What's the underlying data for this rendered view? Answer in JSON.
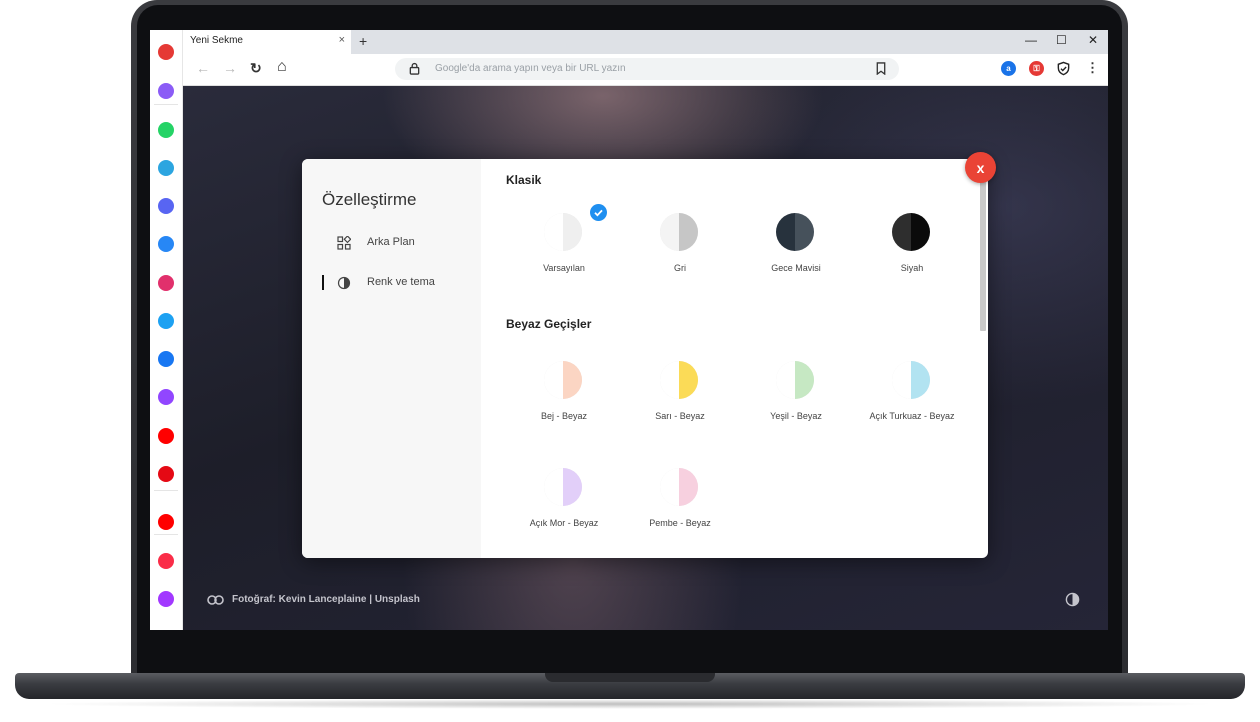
{
  "browser": {
    "tab_title": "Yeni Sekme",
    "tab_close": "×",
    "new_tab": "+",
    "window_controls": {
      "minimize": "—",
      "maximize": "☐",
      "close": "✕"
    },
    "nav": {
      "back": "←",
      "forward": "→",
      "reload": "↻",
      "home": "⌂"
    },
    "omnibox_placeholder": "Google'da arama yapın veya bir URL yazın",
    "menu": "⋮"
  },
  "sidebar_icons": [
    {
      "name": "app-logo-icon",
      "color": "#e53935"
    },
    {
      "name": "messenger-icon",
      "color": "#8b5cf6"
    },
    {
      "name": "whatsapp-icon",
      "color": "#25d366"
    },
    {
      "name": "telegram-icon",
      "color": "#2ca5e0"
    },
    {
      "name": "discord-icon",
      "color": "#5865f2"
    },
    {
      "name": "vk-icon",
      "color": "#2787f5"
    },
    {
      "name": "instagram-icon",
      "color": "#e1306c"
    },
    {
      "name": "twitter-icon",
      "color": "#1da1f2"
    },
    {
      "name": "facebook-icon",
      "color": "#1877f2"
    },
    {
      "name": "twitch-icon",
      "color": "#9146ff"
    },
    {
      "name": "youtube-icon",
      "color": "#ff0000"
    },
    {
      "name": "netflix-icon",
      "color": "#e50914"
    },
    {
      "name": "youtube-music-icon",
      "color": "#ff0000"
    },
    {
      "name": "apple-music-icon",
      "color": "#fa2d48"
    },
    {
      "name": "deezer-icon",
      "color": "#a238ff"
    }
  ],
  "customize": {
    "title": "Özelleştirme",
    "menu": [
      {
        "label": "Arka Plan",
        "icon": "grid-icon",
        "active": false
      },
      {
        "label": "Renk ve tema",
        "icon": "contrast-icon",
        "active": true
      }
    ],
    "sections": [
      {
        "title": "Klasik",
        "items": [
          {
            "label": "Varsayılan",
            "left": "#ffffff",
            "right": "#efefef",
            "selected": true
          },
          {
            "label": "Gri",
            "left": "#f4f4f4",
            "right": "#c6c6c6",
            "selected": false
          },
          {
            "label": "Gece Mavisi",
            "left": "#27323d",
            "right": "#46515b",
            "selected": false
          },
          {
            "label": "Siyah",
            "left": "#2e2e2e",
            "right": "#0b0b0b",
            "selected": false
          }
        ]
      },
      {
        "title": "Beyaz Geçişler",
        "items": [
          {
            "label": "Bej - Beyaz",
            "left": "#ffffff",
            "right": "#fbd5c3"
          },
          {
            "label": "Sarı - Beyaz",
            "left": "#ffffff",
            "right": "#fbdb57"
          },
          {
            "label": "Yeşil - Beyaz",
            "left": "#ffffff",
            "right": "#c6e8c3"
          },
          {
            "label": "Açık Turkuaz - Beyaz",
            "left": "#ffffff",
            "right": "#b2e3f1"
          },
          {
            "label": "Açık Mor - Beyaz",
            "left": "#ffffff",
            "right": "#e2cff9"
          },
          {
            "label": "Pembe - Beyaz",
            "left": "#ffffff",
            "right": "#f7d0df"
          }
        ]
      }
    ],
    "close_label": "x"
  },
  "footer": {
    "credit": "Fotoğraf: Kevin Lanceplaine | Unsplash"
  }
}
